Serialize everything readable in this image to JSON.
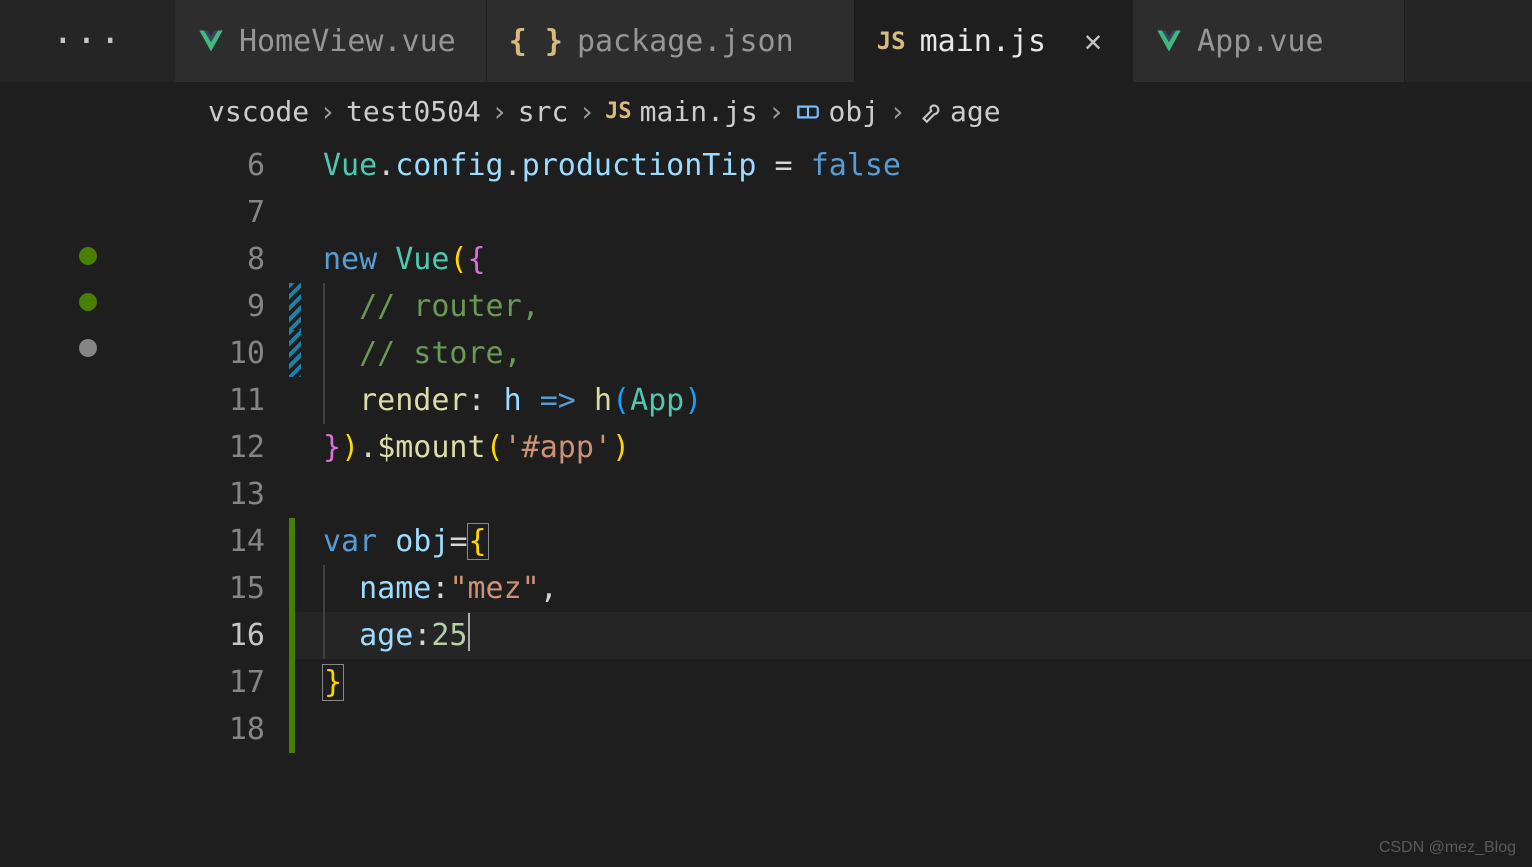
{
  "tabs": {
    "ellipsis": "···",
    "items": [
      {
        "label": "HomeView.vue",
        "icon": "vue"
      },
      {
        "label": "package.json",
        "icon": "json"
      },
      {
        "label": "main.js",
        "icon": "js",
        "active": true,
        "close": "✕"
      },
      {
        "label": "App.vue",
        "icon": "vue"
      }
    ]
  },
  "breadcrumb": {
    "parts": [
      "vscode",
      "test0504",
      "src"
    ],
    "file": "main.js",
    "symbol1": "obj",
    "symbol2": "age",
    "sep": "›"
  },
  "line_numbers": [
    "6",
    "7",
    "8",
    "9",
    "10",
    "11",
    "12",
    "13",
    "14",
    "15",
    "16",
    "17",
    "18"
  ],
  "active_line": "16",
  "code": {
    "l6": {
      "a": "Vue",
      "b": ".",
      "c": "config",
      "d": ".",
      "e": "productionTip",
      "f": " = ",
      "g": "false"
    },
    "l8": {
      "a": "new",
      "b": " ",
      "c": "Vue",
      "d": "(",
      "e": "{"
    },
    "l9": {
      "a": "// router,"
    },
    "l10": {
      "a": "// store,"
    },
    "l11": {
      "a": "render",
      "b": ": ",
      "c": "h",
      "d": " => ",
      "e": "h",
      "f": "(",
      "g": "App",
      "h": ")"
    },
    "l12": {
      "a": "}",
      "b": ")",
      "c": ".",
      "d": "$mount",
      "e": "(",
      "f": "'#app'",
      "g": ")"
    },
    "l14": {
      "a": "var",
      "b": " ",
      "c": "obj",
      "d": "=",
      "e": "{"
    },
    "l15": {
      "a": "name",
      "b": ":",
      "c": "\"mez\"",
      "d": ","
    },
    "l16": {
      "a": "age",
      "b": ":",
      "c": "25"
    },
    "l17": {
      "a": "}"
    }
  },
  "watermark": "CSDN @mez_Blog"
}
